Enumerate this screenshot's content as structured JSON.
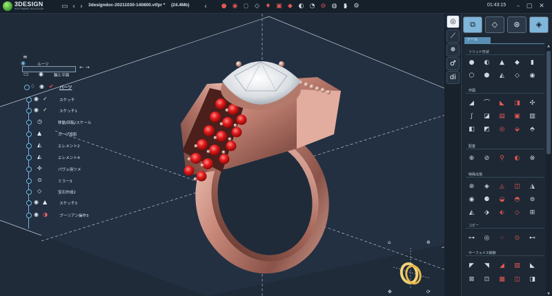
{
  "app": {
    "logo_name": "3DESIGN",
    "logo_tagline": "SOFTWARE SOLUTION",
    "document_name": "3designdoc-20211030-140800.vtfpr *",
    "document_size": "(24.4Mb)",
    "clock": "01:43:15"
  },
  "tree": {
    "root": {
      "label": "ルーツ"
    },
    "axes": {
      "label": "軸と平面"
    },
    "parts": {
      "label": "パーツ"
    },
    "children": [
      {
        "label": "スケッチ",
        "icon": "checkmark-icon"
      },
      {
        "label": "スケッチ1",
        "icon": "checkmark-icon"
      },
      {
        "label": "移動/回転/スケール",
        "icon": "transform-icon"
      },
      {
        "label": "カーブ投影",
        "icon": "curve-projection-icon"
      },
      {
        "label": "エレメント2",
        "icon": "element-icon"
      },
      {
        "label": "エレメント4",
        "icon": "element-icon"
      },
      {
        "label": "パヴェ用ツメ",
        "icon": "prong-icon"
      },
      {
        "label": "ミラー3",
        "icon": "mirror-icon"
      },
      {
        "label": "宝石作成2",
        "icon": "gem-icon"
      },
      {
        "label": "スケッチ3",
        "icon": "sketch-icon"
      },
      {
        "label": "ブーリアン操作3",
        "icon": "boolean-icon"
      }
    ]
  },
  "panel": {
    "subtab": "ツール",
    "sections": [
      {
        "title": "ソリッド形状"
      },
      {
        "title": "作図"
      },
      {
        "title": "配置"
      },
      {
        "title": "特殊出現"
      },
      {
        "title": "コピー"
      },
      {
        "title": "サーフェイス制御"
      }
    ]
  },
  "colors": {
    "accent": "#7fb6da",
    "background": "#1f2b39",
    "metal": "#c98d7c",
    "ruby": "#d81c1c",
    "diamond": "#e8ecef"
  }
}
